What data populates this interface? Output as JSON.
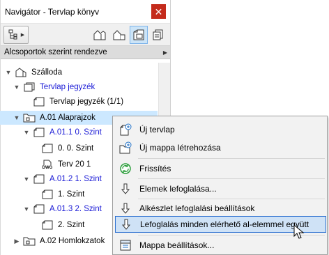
{
  "window": {
    "title": "Navigátor - Tervlap könyv",
    "close_glyph": "✕"
  },
  "toolbar": {
    "tree_button_icon": "tree-structure-icon",
    "dropdown_glyph": "▶",
    "icons": [
      "project-map-icon",
      "view-map-icon",
      "layout-book-icon",
      "publisher-sets-icon"
    ]
  },
  "group_bar": {
    "label": "Alcsoportok szerint rendezve",
    "arrow": "▶"
  },
  "tree": [
    {
      "label": "Szálloda",
      "expander": "▼",
      "icon": "building-icon",
      "blue": false
    },
    {
      "label": "Tervlap jegyzék",
      "expander": "▼",
      "icon": "layout-list-icon",
      "blue": true
    },
    {
      "label": "Tervlap jegyzék (1/1)",
      "expander": "",
      "icon": "layout-icon",
      "blue": false
    },
    {
      "label": "A.01 Alaprajzok",
      "expander": "▼",
      "icon": "folder-icon",
      "blue": false,
      "selected": true
    },
    {
      "label": "A.01.1 0. Szint",
      "expander": "▼",
      "icon": "subset-icon",
      "blue": true
    },
    {
      "label": "0. 0. Szint",
      "expander": "",
      "icon": "layout-icon",
      "blue": false
    },
    {
      "label": "Terv 20 1",
      "expander": "",
      "icon": "dwg-icon",
      "blue": false
    },
    {
      "label": "A.01.2 1. Szint",
      "expander": "▼",
      "icon": "subset-icon",
      "blue": true
    },
    {
      "label": "1. Szint",
      "expander": "",
      "icon": "layout-icon",
      "blue": false
    },
    {
      "label": "A.01.3 2. Szint",
      "expander": "▼",
      "icon": "subset-icon",
      "blue": true
    },
    {
      "label": "2. Szint",
      "expander": "",
      "icon": "layout-icon",
      "blue": false
    },
    {
      "label": "A.02 Homlokzatok",
      "expander": "▶",
      "icon": "folder-icon",
      "blue": false
    }
  ],
  "dwg_text": "DWG",
  "menu": [
    {
      "label": "Új tervlap",
      "icon": "new-layout-icon"
    },
    {
      "label": "Új mappa létrehozása",
      "icon": "new-folder-icon"
    },
    {
      "label": "Frissítés",
      "icon": "refresh-icon"
    },
    {
      "label": "Elemek lefoglalása...",
      "icon": "reserve-icon"
    },
    {
      "label": "Alkészlet lefoglalási beállítások",
      "icon": "reserve-settings-icon"
    },
    {
      "label": "Lefoglalás minden elérhető al-elemmel együtt",
      "icon": "reserve-all-icon",
      "highlighted": true
    },
    {
      "label": "Mappa beállítások...",
      "icon": "folder-settings-icon"
    }
  ],
  "colors": {
    "close": "#c42b1c",
    "link_blue": "#1a1ad6",
    "selection": "#cce8ff",
    "menu_highlight": "#cfe2f6",
    "menu_highlight_border": "#2b6fd0",
    "refresh_green": "#2a9d3a"
  }
}
